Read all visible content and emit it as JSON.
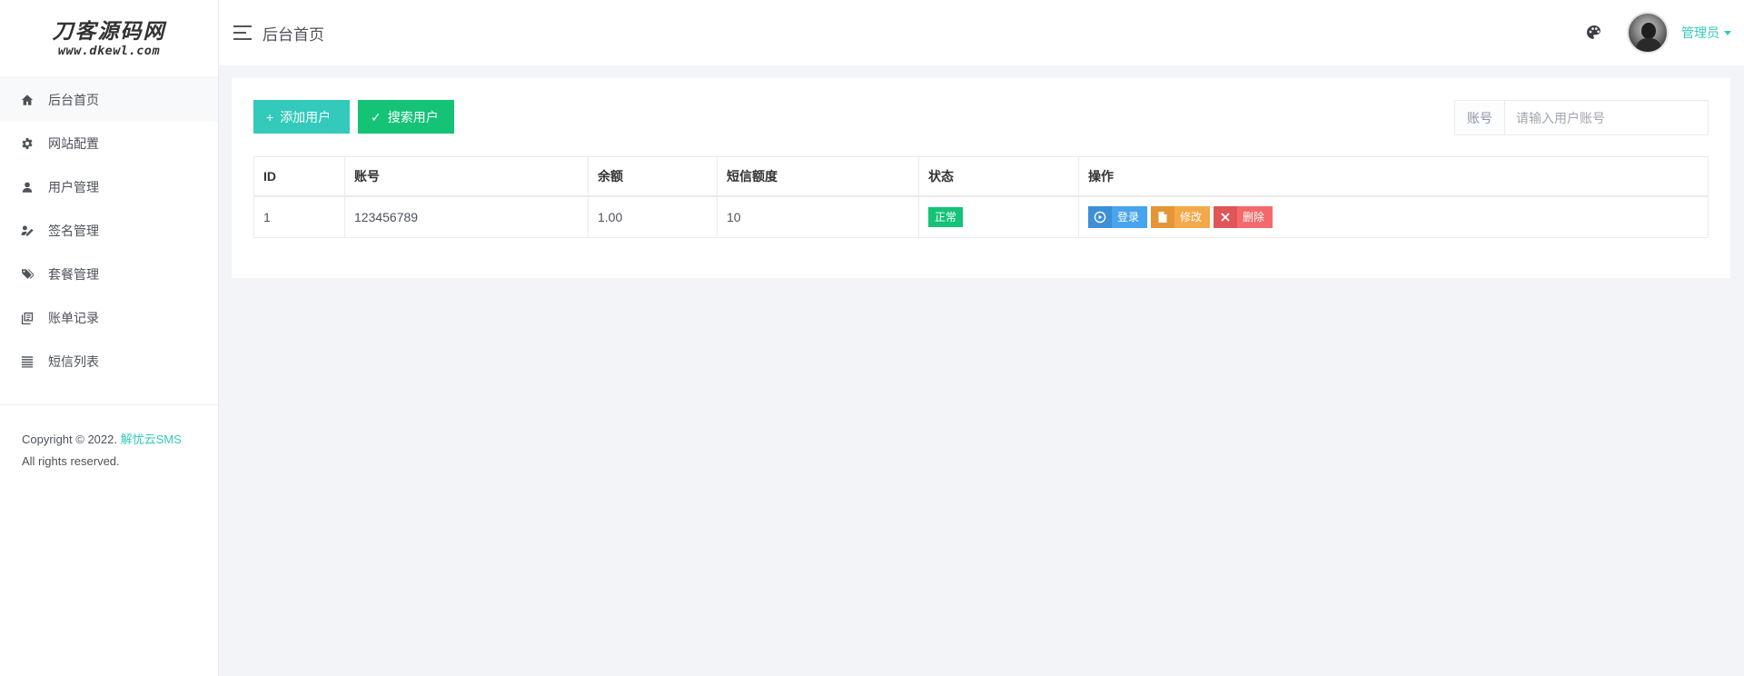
{
  "logo": {
    "main": "刀客源码网",
    "sub": "www.dkewl.com"
  },
  "sidebar": {
    "items": [
      {
        "label": "后台首页",
        "icon": "home-icon",
        "active": true
      },
      {
        "label": "网站配置",
        "icon": "gear-icon",
        "active": false
      },
      {
        "label": "用户管理",
        "icon": "user-icon",
        "active": false
      },
      {
        "label": "签名管理",
        "icon": "signature-icon",
        "active": false
      },
      {
        "label": "套餐管理",
        "icon": "tags-icon",
        "active": false
      },
      {
        "label": "账单记录",
        "icon": "bill-icon",
        "active": false
      },
      {
        "label": "短信列表",
        "icon": "list-icon",
        "active": false
      }
    ],
    "copyright_prefix": "Copyright © 2022.",
    "copyright_brand": "解忧云SMS",
    "copyright_suffix": "All rights reserved."
  },
  "header": {
    "title": "后台首页",
    "user_name": "管理员"
  },
  "toolbar": {
    "add_label": "添加用户",
    "search_label": "搜索用户",
    "search_addon": "账号",
    "search_placeholder": "请输入用户账号"
  },
  "table": {
    "columns": [
      "ID",
      "账号",
      "余额",
      "短信额度",
      "状态",
      "操作"
    ],
    "rows": [
      {
        "id": "1",
        "account": "123456789",
        "balance": "1.00",
        "quota": "10",
        "status": "正常",
        "actions": {
          "login": "登录",
          "edit": "修改",
          "delete": "删除"
        }
      }
    ]
  },
  "colors": {
    "accent": "#33cabb",
    "success": "#15c377",
    "info": "#48a4ec",
    "warning": "#f3a94a",
    "danger": "#f36a6a"
  }
}
